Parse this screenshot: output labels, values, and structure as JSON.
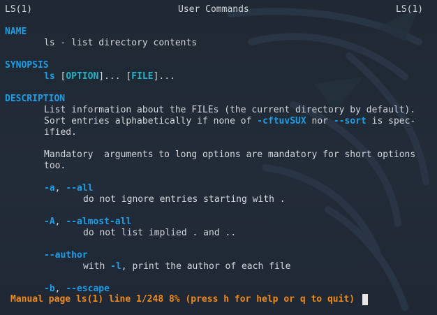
{
  "header": {
    "left": "LS(1)",
    "center": "User Commands",
    "right": "LS(1)"
  },
  "name_section": {
    "heading": "NAME",
    "text": "ls - list directory contents"
  },
  "synopsis_section": {
    "heading": "SYNOPSIS",
    "command": "ls",
    "open1": "[",
    "arg1": "OPTION",
    "close1": "]...",
    "open2": "[",
    "arg2": "FILE",
    "close2": "]..."
  },
  "description_section": {
    "heading": "DESCRIPTION",
    "p1_line1": "List information about the FILEs (the current directory by default).",
    "p1_line2_a": "Sort entries alphabetically if none of ",
    "p1_line2_opt1": "-cftuvSUX",
    "p1_line2_b": " nor ",
    "p1_line2_opt2": "--sort",
    "p1_line2_c": " is spec-",
    "p1_line3": "ified.",
    "p2_line1": "Mandatory  arguments to long options are mandatory for short options",
    "p2_line2": "too."
  },
  "options": [
    {
      "short": "-a",
      "sep": ", ",
      "long": "--all",
      "desc_a": "do not ignore entries starting with .",
      "desc_opt": "",
      "desc_b": ""
    },
    {
      "short": "-A",
      "sep": ", ",
      "long": "--almost-all",
      "desc_a": "do not list implied . and ..",
      "desc_opt": "",
      "desc_b": ""
    },
    {
      "short": "",
      "sep": "",
      "long": "--author",
      "desc_a": "with ",
      "desc_opt": "-l",
      "desc_b": ", print the author of each file"
    },
    {
      "short": "-b",
      "sep": ", ",
      "long": "--escape",
      "desc_a": "",
      "desc_opt": "",
      "desc_b": ""
    }
  ],
  "status_bar": {
    "text": "Manual page ls(1) line 1/248 8% (press h for help or q to quit)"
  },
  "colors": {
    "background": "#202a36",
    "text": "#d3d7dc",
    "section": "#1e9ee6",
    "synopsis_arg": "#20b3c9",
    "status": "#ef8a1c"
  }
}
